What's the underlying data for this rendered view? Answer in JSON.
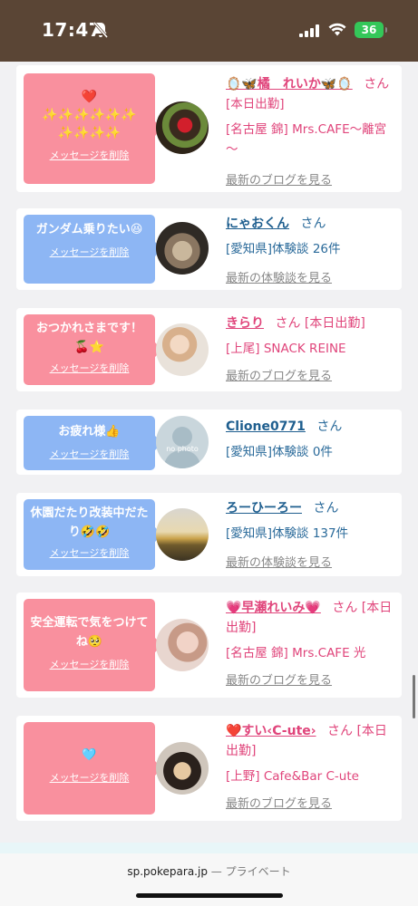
{
  "status": {
    "time": "17:47",
    "battery": "36"
  },
  "delete_label": "メッセージを削除",
  "cards": [
    {
      "message": "❤️\n✨✨✨✨✨✨\n✨✨✨✨",
      "name": "🪞🦋橘　れいか🦋🪞",
      "san": "さん",
      "status_tag": "[本日出勤]",
      "detail": "[名古屋 錦] Mrs.CAFE～離宮～",
      "latest": "最新のブログを見る"
    },
    {
      "message": "ガンダム乗りたい😆",
      "name": "にゃおくん",
      "san": "さん",
      "status_tag": "",
      "detail": "[愛知県]体験談 26件",
      "latest": "最新の体験談を見る"
    },
    {
      "message": "おつかれさまです！🍒⭐",
      "name": "きらり",
      "san": "さん",
      "status_tag": "[本日出勤]",
      "detail": "[上尾] SNACK REINE",
      "latest": "最新のブログを見る"
    },
    {
      "message": "お疲れ様👍",
      "name": "Clione0771",
      "san": "さん",
      "status_tag": "",
      "detail": "[愛知県]体験談 0件",
      "latest": "",
      "avatar_text": "no photo"
    },
    {
      "message": "休園だたり改装中だたり🤣🤣",
      "name": "ろーひーろー",
      "san": "さん",
      "status_tag": "",
      "detail": "[愛知県]体験談 137件",
      "latest": "最新の体験談を見る"
    },
    {
      "message": "安全運転で気をつけてね🥺",
      "name": "💗早瀬れいみ💗",
      "san": "さん",
      "status_tag": "[本日出勤]",
      "detail": "[名古屋 錦] Mrs.CAFE 光",
      "latest": "最新のブログを見る"
    },
    {
      "message": "🩵",
      "name": "❤️すい‹C-ute›",
      "san": "さん",
      "status_tag": "[本日出勤]",
      "detail": "[上野] Cafe&Bar C-ute",
      "latest": "最新のブログを見る"
    }
  ],
  "footer": {
    "url": "sp.pokepara.jp",
    "separator": "—",
    "label": "プライベート"
  }
}
